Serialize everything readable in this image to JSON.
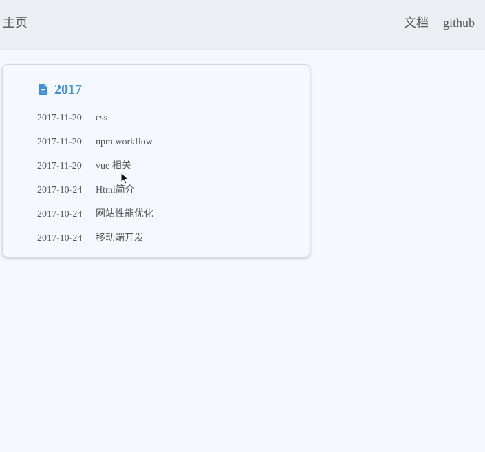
{
  "nav": {
    "home_label": "主页",
    "docs_label": "文档",
    "github_label": "github"
  },
  "archive": {
    "year": "2017",
    "icon": "document-icon",
    "accent_color": "#3f8fdc",
    "posts": [
      {
        "date": "2017-11-20",
        "title": "css"
      },
      {
        "date": "2017-11-20",
        "title": "npm workflow"
      },
      {
        "date": "2017-11-20",
        "title": "vue 相关"
      },
      {
        "date": "2017-10-24",
        "title": "Html简介"
      },
      {
        "date": "2017-10-24",
        "title": "网站性能优化"
      },
      {
        "date": "2017-10-24",
        "title": "移动端开发"
      }
    ]
  }
}
